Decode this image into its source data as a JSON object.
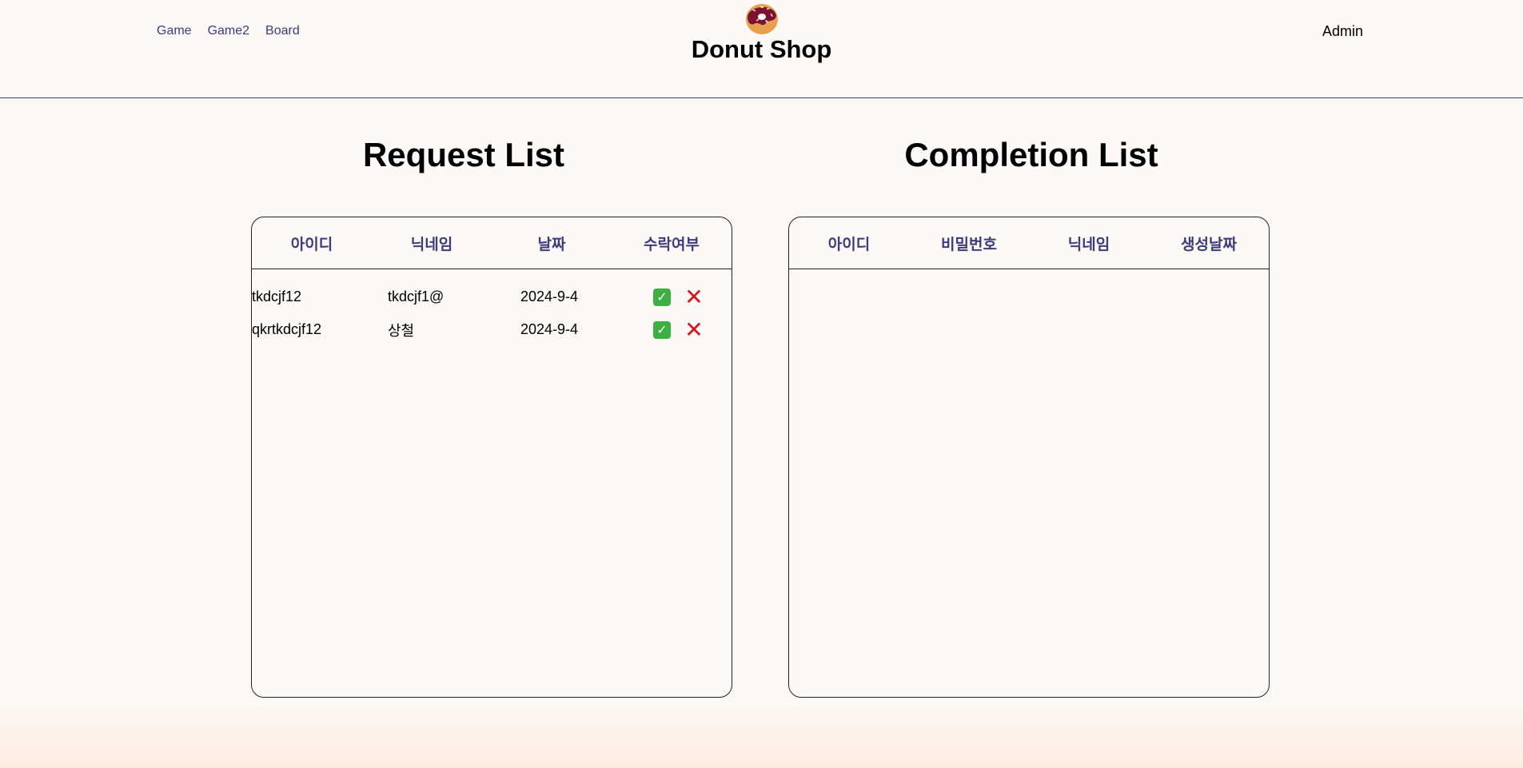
{
  "nav": {
    "items": [
      "Game",
      "Game2",
      "Board"
    ]
  },
  "brand": {
    "title": "Donut Shop",
    "logo_icon": "donut-icon"
  },
  "user": {
    "label": "Admin"
  },
  "request": {
    "title": "Request List",
    "headers": [
      "아이디",
      "닉네임",
      "날짜",
      "수락여부"
    ],
    "rows": [
      {
        "id": "tkdcjf12",
        "nickname": "tkdcjf1@",
        "date": "2024-9-4"
      },
      {
        "id": "qkrtkdcjf12",
        "nickname": "상철",
        "date": "2024-9-4"
      }
    ],
    "accept_icon": "check-mark-button-icon",
    "reject_icon": "cross-mark-icon"
  },
  "completion": {
    "title": "Completion List",
    "headers": [
      "아이디",
      "비밀번호",
      "닉네임",
      "생성날짜"
    ],
    "rows": []
  },
  "colors": {
    "accent": "#3a3c7c",
    "accept": "#3cb043",
    "reject": "#d8131f",
    "background": "#fcf8f5"
  }
}
